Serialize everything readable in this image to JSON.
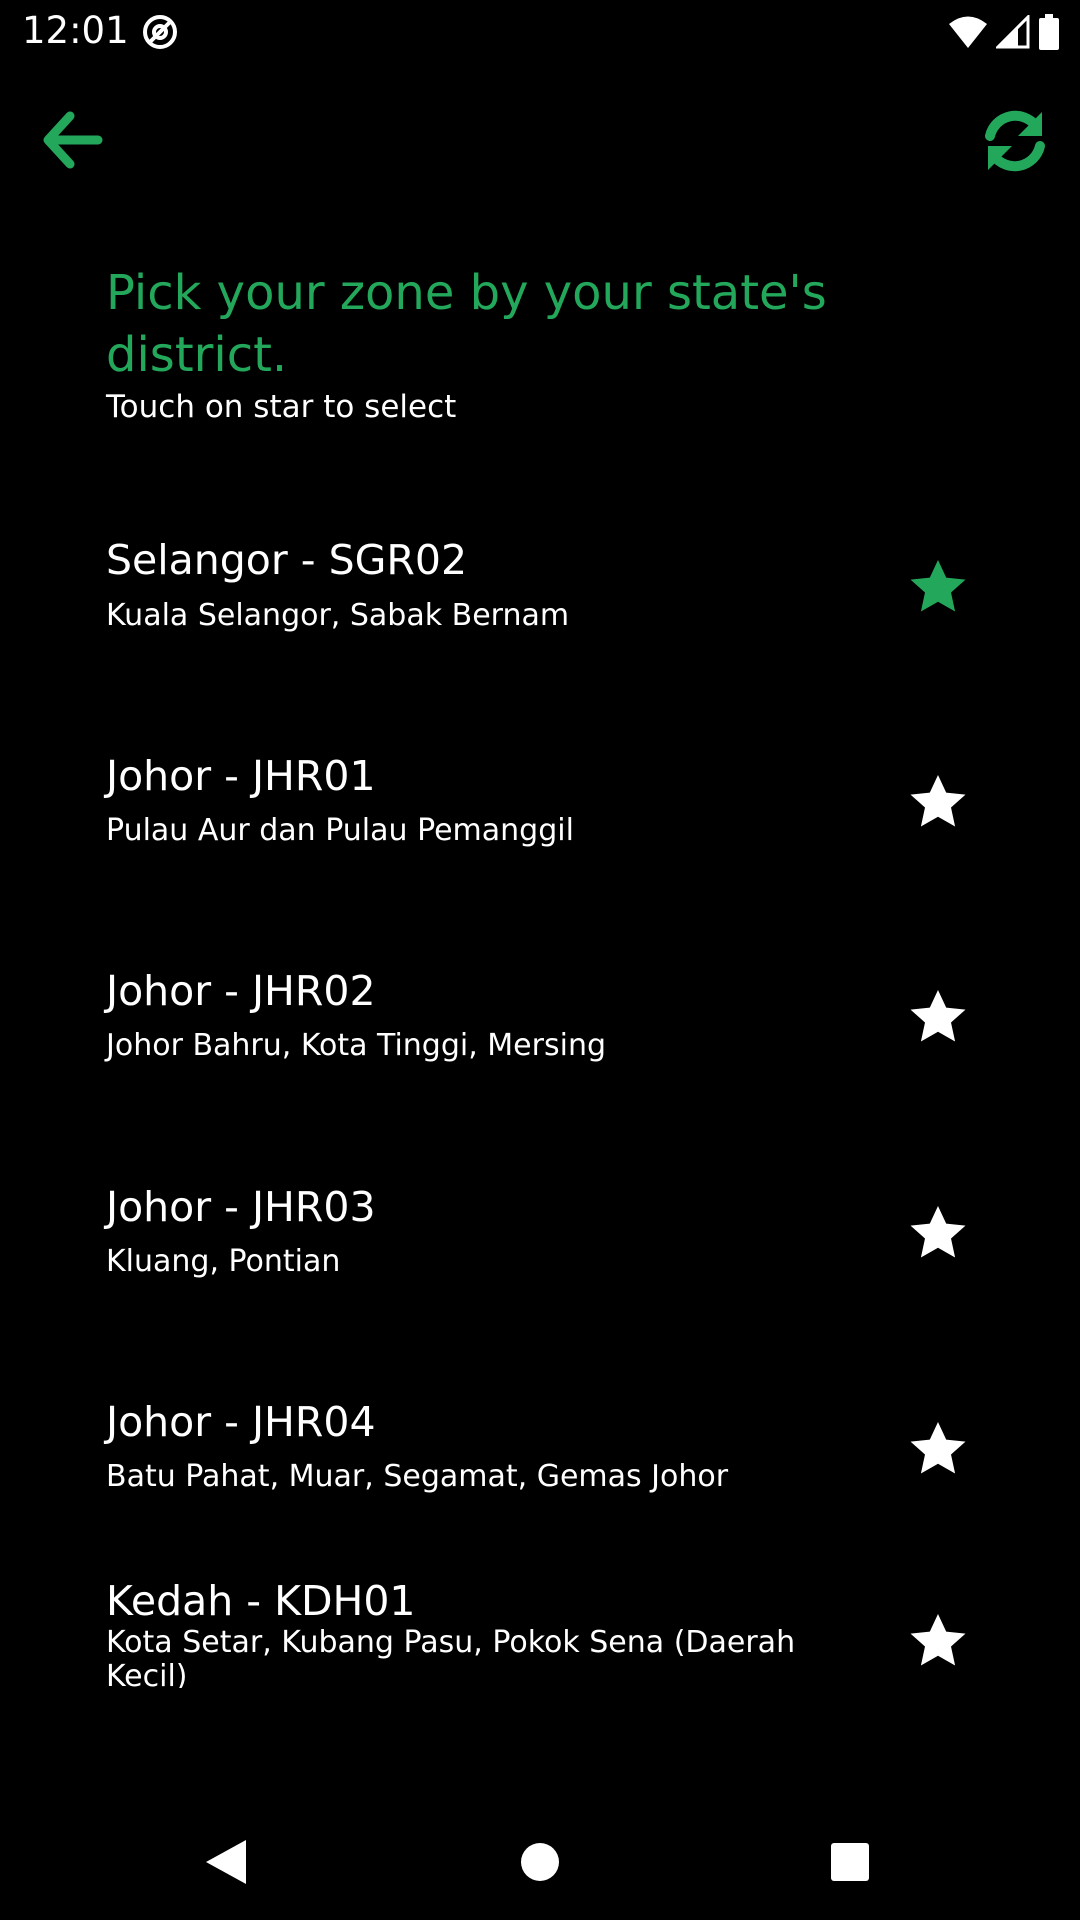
{
  "status_bar": {
    "time": "12:01",
    "icons": [
      "at-sign-icon",
      "wifi-icon",
      "signal-icon",
      "battery-icon"
    ]
  },
  "toolbar": {
    "back_icon": "arrow-left-icon",
    "refresh_icon": "refresh-icon"
  },
  "colors": {
    "accent": "#23A85B",
    "background": "#000000",
    "text": "#ffffff"
  },
  "heading": "Pick your zone by your state's district.",
  "subheading": "Touch on star to select",
  "zones": [
    {
      "title": "Selangor - SGR02",
      "districts": "Kuala Selangor, Sabak Bernam",
      "selected": true
    },
    {
      "title": "Johor - JHR01",
      "districts": "Pulau Aur dan Pulau Pemanggil",
      "selected": false
    },
    {
      "title": "Johor - JHR02",
      "districts": "Johor Bahru, Kota Tinggi, Mersing",
      "selected": false
    },
    {
      "title": "Johor - JHR03",
      "districts": "Kluang, Pontian",
      "selected": false
    },
    {
      "title": "Johor - JHR04",
      "districts": "Batu Pahat, Muar, Segamat, Gemas Johor",
      "selected": false
    },
    {
      "title": "Kedah - KDH01",
      "districts": "Kota Setar, Kubang Pasu, Pokok Sena (Daerah Kecil)",
      "selected": false
    }
  ],
  "nav_bar": {
    "icons": [
      "nav-back-icon",
      "nav-home-icon",
      "nav-recents-icon"
    ]
  }
}
